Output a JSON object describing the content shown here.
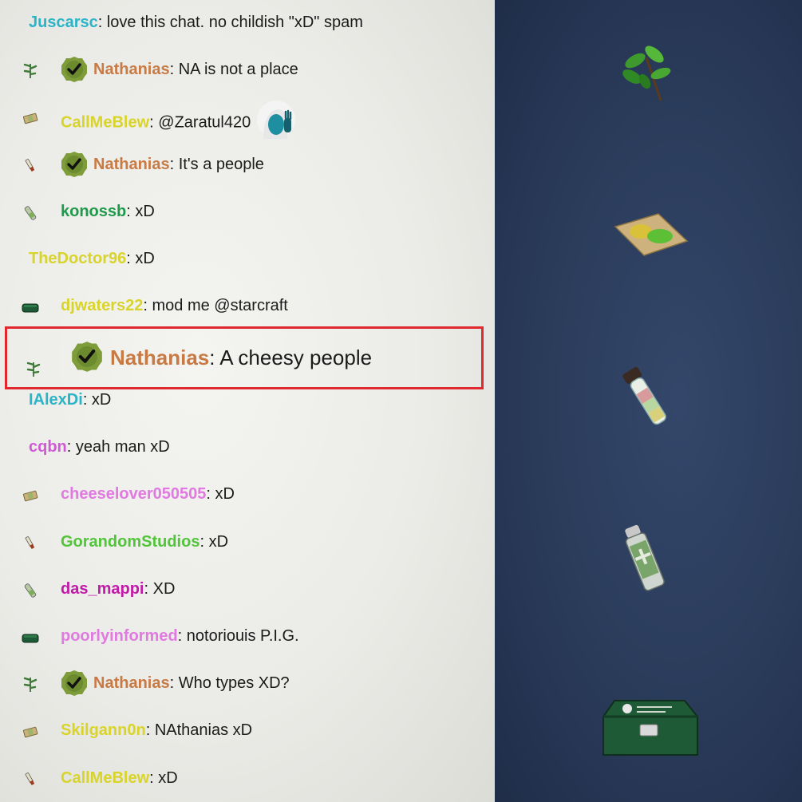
{
  "chat": {
    "messages": [
      {
        "name": "Juscarsc",
        "color": "#2bb3c7",
        "text": ": love this chat. no childish \"xD\" spam",
        "icon": "",
        "badge": false
      },
      {
        "name": "Nathanias",
        "color": "#c87a45",
        "text": ": NA is not a place",
        "icon": "herb-icon",
        "badge": true
      },
      {
        "name": "CallMeBlew",
        "color": "#d9d42b",
        "text": ": @Zaratul420",
        "icon": "bandage-icon",
        "badge": false,
        "emote": "facepalm-emote"
      },
      {
        "name": "Nathanias",
        "color": "#c87a45",
        "text": ": It's a people",
        "icon": "syringe-icon",
        "badge": true
      },
      {
        "name": "konossb",
        "color": "#1f9a4a",
        "text": ": xD",
        "icon": "vial-icon",
        "badge": false
      },
      {
        "name": "TheDoctor96",
        "color": "#d9d42b",
        "text": ": xD",
        "icon": "",
        "badge": false
      },
      {
        "name": "djwaters22",
        "color": "#d9d42b",
        "text": ": mod me @starcraft",
        "icon": "medkit-icon",
        "badge": false
      },
      {
        "name": "Nathanias",
        "color": "#c87a45",
        "text": ": A cheesy people",
        "icon": "herb-icon",
        "badge": true,
        "highlight": true
      },
      {
        "name": "IAlexDi",
        "color": "#2bb3c7",
        "text": ": xD",
        "icon": "",
        "badge": false
      },
      {
        "name": "cqbn",
        "color": "#d05ad6",
        "text": ": yeah man xD",
        "icon": "",
        "badge": false
      },
      {
        "name": "cheeselover050505",
        "color": "#e07ae0",
        "text": ": xD",
        "icon": "bandage-icon",
        "badge": false
      },
      {
        "name": "GorandomStudios",
        "color": "#52c43a",
        "text": ": xD",
        "icon": "syringe-icon",
        "badge": false
      },
      {
        "name": "das_mappi",
        "color": "#c21aa8",
        "text": ": XD",
        "icon": "vial-icon",
        "badge": false
      },
      {
        "name": "poorlyinformed",
        "color": "#e07ae0",
        "text": ": notoriouis P.I.G.",
        "icon": "medkit-icon",
        "badge": false
      },
      {
        "name": "Nathanias",
        "color": "#c87a45",
        "text": ": Who types XD?",
        "icon": "herb-icon",
        "badge": true
      },
      {
        "name": "Skilgann0n",
        "color": "#d9d42b",
        "text": ": NAthanias xD",
        "icon": "bandage-icon",
        "badge": false
      },
      {
        "name": "CallMeBlew",
        "color": "#d9d42b",
        "text": ": xD",
        "icon": "syringe-icon",
        "badge": false
      }
    ]
  },
  "inventory": {
    "items": [
      "herb-item",
      "bandage-item",
      "vial-item",
      "spray-item",
      "medkit-item"
    ]
  },
  "colors": {
    "highlight_border": "#e0282e",
    "badge_bg": "#7e9c3a"
  }
}
